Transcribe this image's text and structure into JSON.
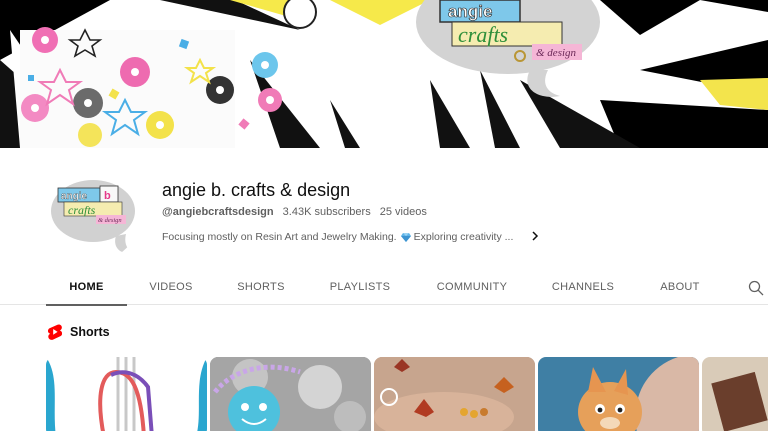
{
  "channel": {
    "name": "angie b. crafts & design",
    "handle": "@angiebcraftsdesign",
    "subscribers": "3.43K subscribers",
    "videos": "25 videos",
    "description_start": "Focusing mostly on Resin Art and Jewelry Making.",
    "description_end": "Exploring creativity ..."
  },
  "logo_text": {
    "line1": "angie b.",
    "line2": "crafts",
    "line3": "& design"
  },
  "tabs": [
    {
      "label": "HOME",
      "active": true
    },
    {
      "label": "VIDEOS",
      "active": false
    },
    {
      "label": "SHORTS",
      "active": false
    },
    {
      "label": "PLAYLISTS",
      "active": false
    },
    {
      "label": "COMMUNITY",
      "active": false
    },
    {
      "label": "CHANNELS",
      "active": false
    },
    {
      "label": "ABOUT",
      "active": false
    }
  ],
  "shorts": {
    "title": "Shorts"
  },
  "colors": {
    "accent_red": "#ff0000",
    "tab_underline": "#606060",
    "text_primary": "#0f0f0f",
    "text_secondary": "#606060"
  },
  "icons": [
    "search-icon",
    "chevron-right-icon",
    "shorts-icon",
    "gem-icon"
  ]
}
